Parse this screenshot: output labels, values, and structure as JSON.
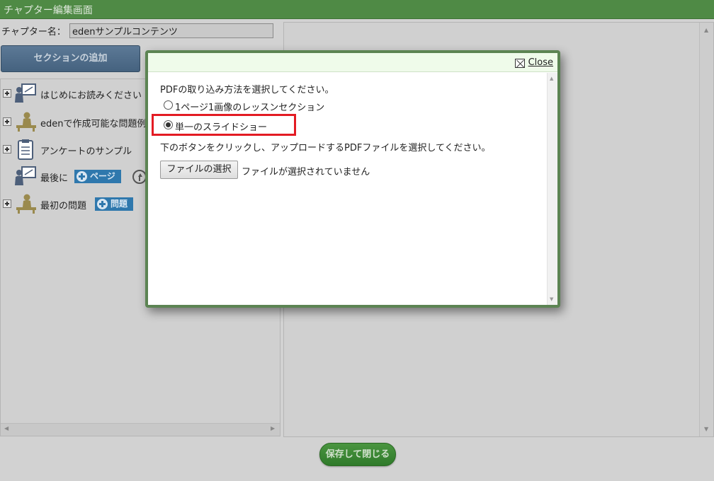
{
  "header": {
    "title": "チャプター編集画面"
  },
  "chapter": {
    "label": "チャプター名：",
    "value": "edenサンプルコンテンツ"
  },
  "toolbar": {
    "add_section_label": "セクションの追加",
    "save_close_label": "保存して閉じる"
  },
  "tree": {
    "items": [
      {
        "label": "はじめにお読みください",
        "icon": "lesson-board-icon"
      },
      {
        "label": "edenで作成可能な問題例",
        "icon": "teacher-desk-icon"
      },
      {
        "label": "アンケートのサンプル",
        "icon": "clipboard-icon"
      },
      {
        "label": "最後に",
        "icon": "lesson-board-icon",
        "button": "ページ"
      },
      {
        "label": "最初の問題",
        "icon": "teacher-desk-icon",
        "button": "問題"
      }
    ]
  },
  "dialog": {
    "close_label": "Close",
    "instruction": "PDFの取り込み方法を選択してください。",
    "options": [
      {
        "label": "1ページ1画像のレッスンセクション",
        "checked": false
      },
      {
        "label": "単一のスライドショー",
        "checked": true
      }
    ],
    "upload_instruction": "下のボタンをクリックし、アップロードするPDFファイルを選択してください。",
    "file_button": "ファイルの選択",
    "file_status": "ファイルが選択されていません"
  },
  "colors": {
    "header": "#4f8a45",
    "dialog_border": "#5c8453",
    "highlight": "#e31b23",
    "tag_button": "#2f78ad"
  }
}
